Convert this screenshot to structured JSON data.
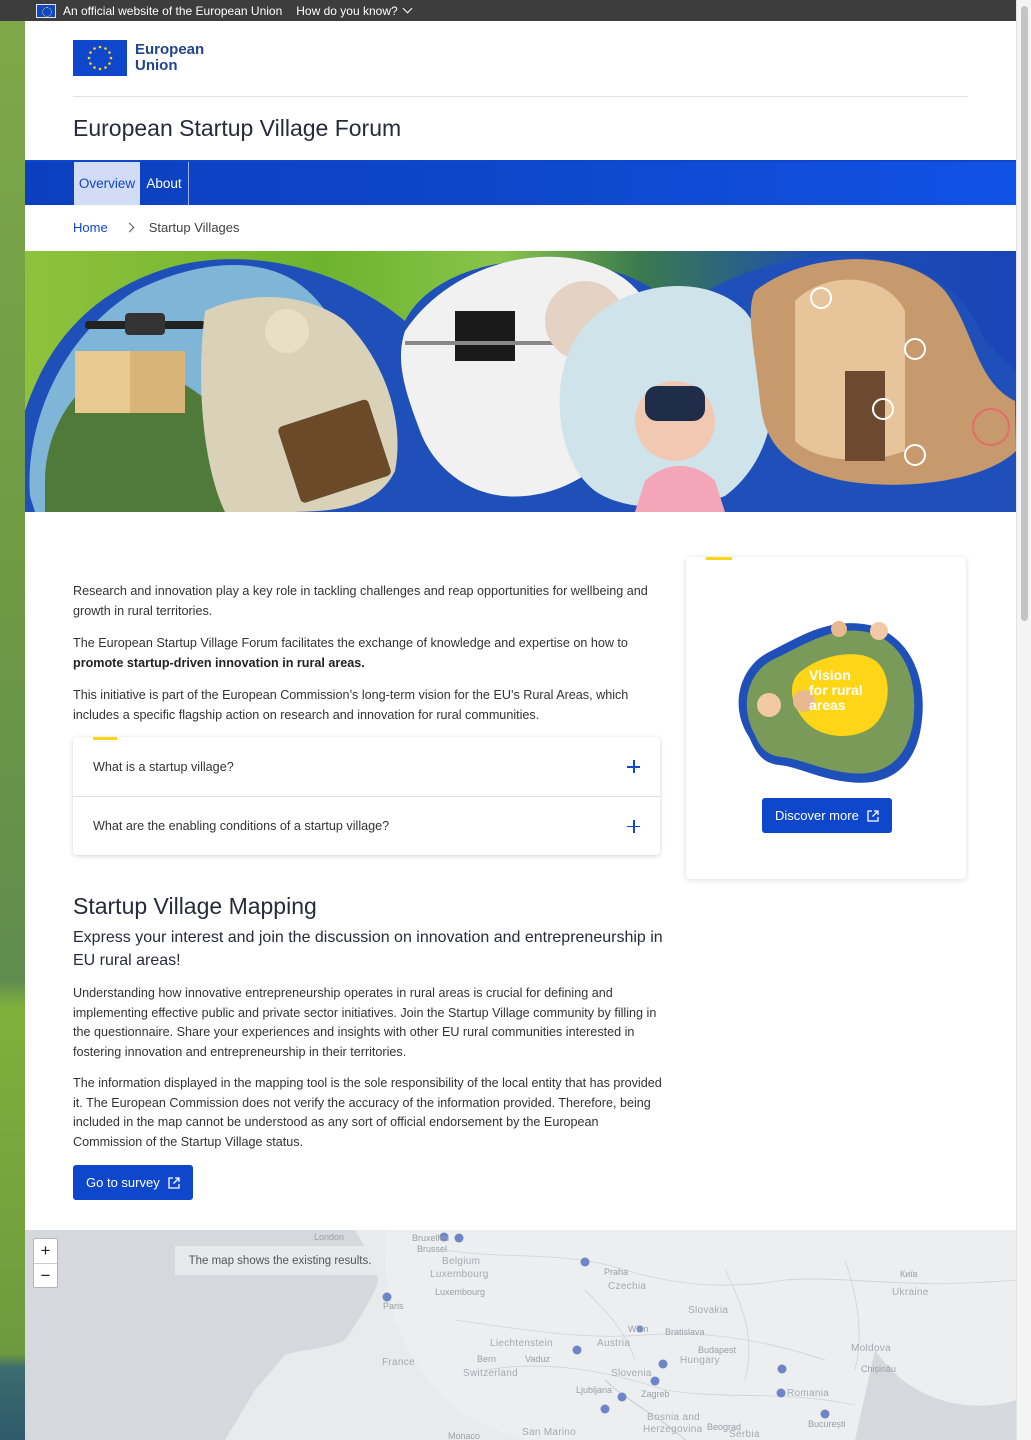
{
  "eu_bar": {
    "official_text": "An official website of the European Union",
    "how_know": "How do you know?"
  },
  "header": {
    "logo_text": "European Union",
    "site_title": "European Startup Village Forum"
  },
  "nav": {
    "items": [
      {
        "label": "Overview",
        "active": true
      },
      {
        "label": "About",
        "active": false
      }
    ]
  },
  "breadcrumb": {
    "home": "Home",
    "current": "Startup Villages"
  },
  "intro": {
    "p1": "Research and innovation play a key role in tackling challenges and reap opportunities for wellbeing and growth in rural territories.",
    "p2_start": "The European Startup Village Forum facilitates the exchange of knowledge and expertise on how to ",
    "p2_bold": "promote startup-driven innovation in rural areas.",
    "p3": "This initiative is part of the European Commission’s long-term vision for the EU’s Rural Areas, which includes a specific flagship action on research and innovation for rural communities."
  },
  "accordion": [
    {
      "label": "What is a startup village?"
    },
    {
      "label": "What are the enabling conditions of a startup village?"
    }
  ],
  "card": {
    "image_text_line1": "Vision",
    "image_text_line2": "for rural",
    "image_text_line3": "areas",
    "button": "Discover more"
  },
  "mapping": {
    "title": "Startup Village Mapping",
    "subtitle": "Express your interest and join the discussion on innovation and entrepreneurship in EU rural areas!",
    "p1": "Understanding how innovative entrepreneurship operates in rural areas is crucial for defining and implementing effective public and private sector initiatives. Join the Startup Village community by filling in the questionnaire. Share your experiences and insights with other EU rural communities interested in fostering innovation and entrepreneurship in their territories.",
    "p2": "The information displayed in the mapping tool is the sole responsibility of the local entity that has provided it. The European Commission does not verify the accuracy of the information provided. Therefore, being included in the map cannot be understood as any sort of official endorsement by the European Commission of the Startup Village status.",
    "button": "Go to survey"
  },
  "map": {
    "zoom_in": "+",
    "zoom_out": "−",
    "note": "The map shows the existing results.",
    "labels": {
      "london": "London",
      "bruxelles": "Bruxelles",
      "brussel": "Brussel",
      "belgium": "Belgium",
      "luxembourg_country": "Luxembourg",
      "luxembourg_city": "Luxembourg",
      "paris": "Paris",
      "praha": "Praha",
      "czechia": "Czechia",
      "kyiv": "Київ",
      "ukraine": "Ukraine",
      "slovakia": "Slovakia",
      "wien": "Wien",
      "bratislava": "Bratislava",
      "france": "France",
      "liechtenstein": "Liechtenstein",
      "austria": "Austria",
      "budapest": "Budapest",
      "moldova": "Moldova",
      "chisinau": "Chișinău",
      "bern": "Bern",
      "vaduz": "Vaduz",
      "hungary": "Hungary",
      "switzerland": "Switzerland",
      "slovenia": "Slovenia",
      "ljubljana": "Ljubljana",
      "zagreb": "Zagreb",
      "romania": "Romania",
      "bosnia": "Bosnia and",
      "herzegovina": "Herzegovina",
      "beograd": "Beograd",
      "serbia": "Serbia",
      "bucuresti": "București",
      "monaco": "Monaco",
      "san_marino": "San Marino"
    }
  }
}
